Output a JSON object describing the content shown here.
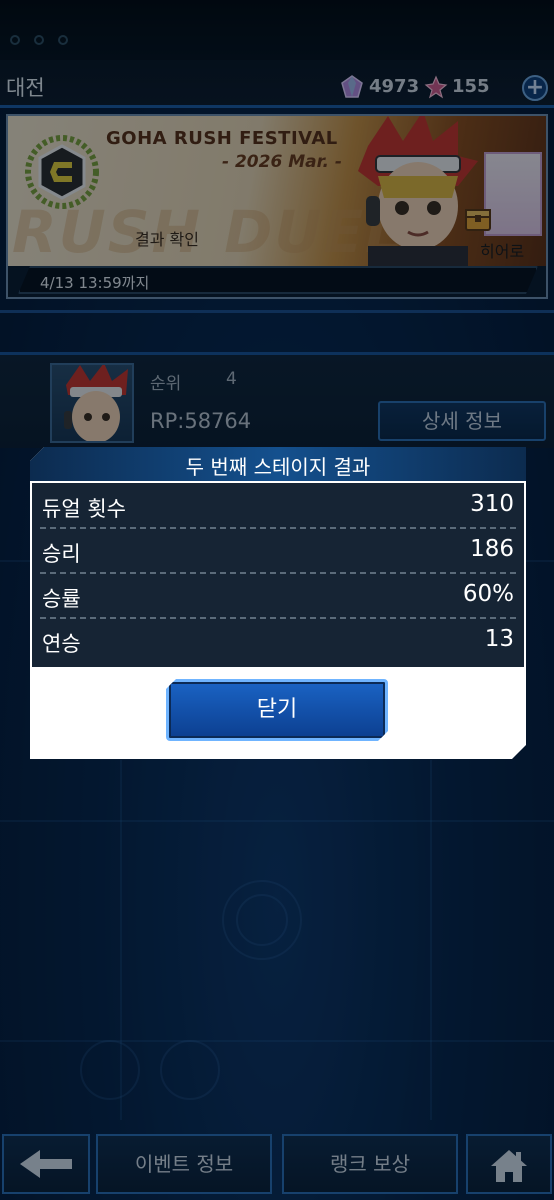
{
  "header": {
    "title": "대전",
    "gems": "4973",
    "tickets": "155"
  },
  "banner": {
    "festival_title": "GOHA RUSH FESTIVAL",
    "festival_date": "- 2026 Mar. -",
    "background_text": "RUSH DUEL",
    "result_check": "결과 확인",
    "hero_label": "히어로",
    "deadline": "4/13 13:59까지"
  },
  "rank": {
    "label": "순위",
    "value": "4",
    "rp": "RP:58764",
    "detail_button": "상세 정보"
  },
  "modal": {
    "title": "두 번째 스테이지 결과",
    "rows": [
      {
        "label": "듀얼 횟수",
        "value": "310"
      },
      {
        "label": "승리",
        "value": "186"
      },
      {
        "label": "승률",
        "value": "60%"
      },
      {
        "label": "연승",
        "value": "13"
      }
    ],
    "close_button": "닫기"
  },
  "nav": {
    "event_info": "이벤트 정보",
    "rank_reward": "랭크 보상"
  },
  "colors": {
    "accent": "#1c5da6",
    "button": "#1a63c4",
    "panel": "#162434"
  }
}
